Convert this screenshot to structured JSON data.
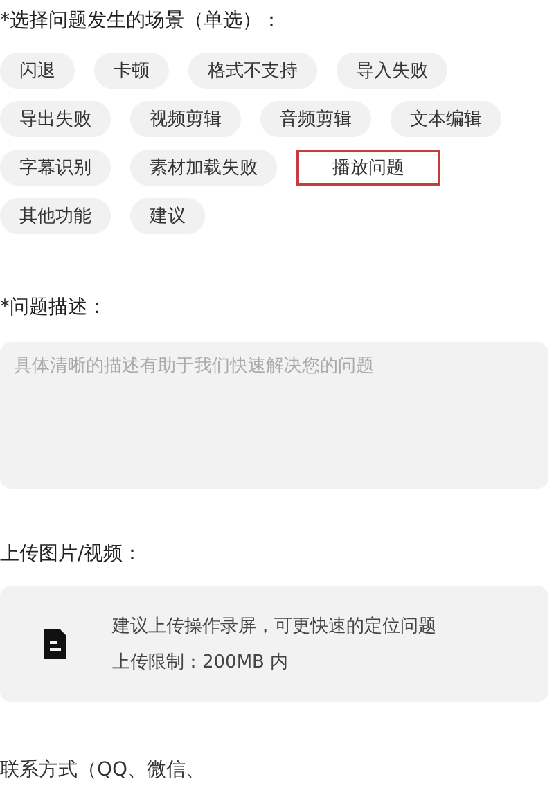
{
  "scene_label": "*选择问题发生的场景（单选）：",
  "scenes": [
    {
      "label": "闪退",
      "selected": false
    },
    {
      "label": "卡顿",
      "selected": false
    },
    {
      "label": "格式不支持",
      "selected": false
    },
    {
      "label": "导入失败",
      "selected": false
    },
    {
      "label": "导出失败",
      "selected": false
    },
    {
      "label": "视频剪辑",
      "selected": false
    },
    {
      "label": "音频剪辑",
      "selected": false
    },
    {
      "label": "文本编辑",
      "selected": false
    },
    {
      "label": "字幕识别",
      "selected": false
    },
    {
      "label": "素材加载失败",
      "selected": false
    },
    {
      "label": "播放问题",
      "selected": true
    },
    {
      "label": "其他功能",
      "selected": false
    },
    {
      "label": "建议",
      "selected": false
    }
  ],
  "description": {
    "label": "*问题描述：",
    "placeholder": "具体清晰的描述有助于我们快速解决您的问题"
  },
  "upload": {
    "label": "上传图片/视频：",
    "hint": "建议上传操作录屏，可更快速的定位问题",
    "limit": "上传限制：200MB 内"
  },
  "contact": {
    "label": "联系方式（QQ、微信、"
  }
}
